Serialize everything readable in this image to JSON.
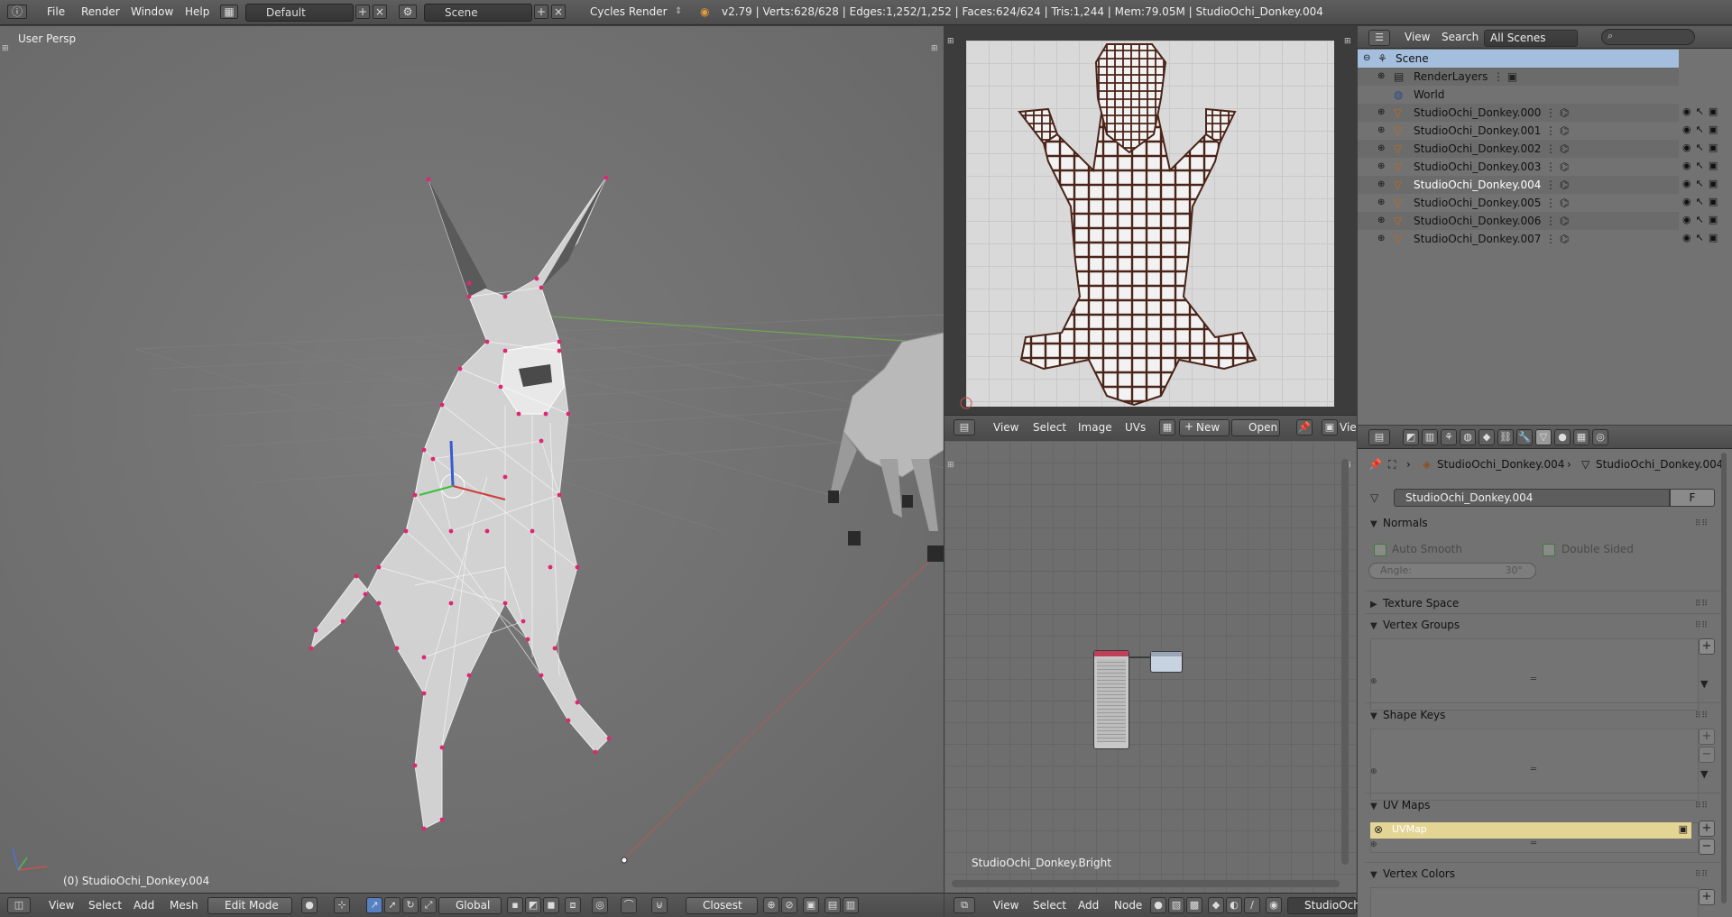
{
  "topbar": {
    "menus": [
      "File",
      "Render",
      "Window",
      "Help"
    ],
    "screen_layout": "Default",
    "scene": "Scene",
    "render_engine": "Cycles Render",
    "stats": "v2.79 | Verts:628/628 | Edges:1,252/1,252 | Faces:624/624 | Tris:1,244 | Mem:79.05M | StudioOchi_Donkey.004"
  },
  "viewport": {
    "view_label": "User Persp",
    "object_label": "(0) StudioOchi_Donkey.004",
    "header": {
      "menus": [
        "View",
        "Select",
        "Add",
        "Mesh"
      ],
      "mode": "Edit Mode",
      "orientation": "Global",
      "snap": "Closest"
    }
  },
  "uv_editor": {
    "header": {
      "menus": [
        "View",
        "Select",
        "Image",
        "UVs"
      ],
      "new_label": "New",
      "open_label": "Open",
      "trailing": "Vie"
    }
  },
  "node_editor": {
    "material_label": "StudioOchi_Donkey.Bright",
    "header": {
      "menus": [
        "View",
        "Select",
        "Add",
        "Node"
      ],
      "material_field": "StudioOchi"
    }
  },
  "outliner": {
    "header": {
      "view": "View",
      "search": "Search",
      "scenes": "All Scenes"
    },
    "rows": [
      {
        "label": "Scene",
        "type": "scene",
        "indent": 0
      },
      {
        "label": "RenderLayers",
        "type": "renderlayers",
        "indent": 1
      },
      {
        "label": "World",
        "type": "world",
        "indent": 1
      },
      {
        "label": "StudioOchi_Donkey.000",
        "type": "object",
        "indent": 1
      },
      {
        "label": "StudioOchi_Donkey.001",
        "type": "object",
        "indent": 1
      },
      {
        "label": "StudioOchi_Donkey.002",
        "type": "object",
        "indent": 1
      },
      {
        "label": "StudioOchi_Donkey.003",
        "type": "object",
        "indent": 1
      },
      {
        "label": "StudioOchi_Donkey.004",
        "type": "object",
        "indent": 1,
        "active": true
      },
      {
        "label": "StudioOchi_Donkey.005",
        "type": "object",
        "indent": 1
      },
      {
        "label": "StudioOchi_Donkey.006",
        "type": "object",
        "indent": 1
      },
      {
        "label": "StudioOchi_Donkey.007",
        "type": "object",
        "indent": 1
      }
    ]
  },
  "properties": {
    "breadcrumb_object": "StudioOchi_Donkey.004",
    "breadcrumb_mesh": "StudioOchi_Donkey.004",
    "mesh_name": "StudioOchi_Donkey.004",
    "fake_user": "F",
    "normals": {
      "title": "Normals",
      "auto_smooth": "Auto Smooth",
      "double_sided": "Double Sided",
      "angle_label": "Angle:",
      "angle_value": "30°"
    },
    "texture_space": "Texture Space",
    "vertex_groups": "Vertex Groups",
    "shape_keys": "Shape Keys",
    "uv_maps": "UV Maps",
    "uv_map_item": "UVMap",
    "vertex_colors": "Vertex Colors"
  },
  "colors": {
    "accent_selected": "#a4bedd",
    "uv_item": "#e5d595",
    "wire_vertex": "#e0266f"
  }
}
